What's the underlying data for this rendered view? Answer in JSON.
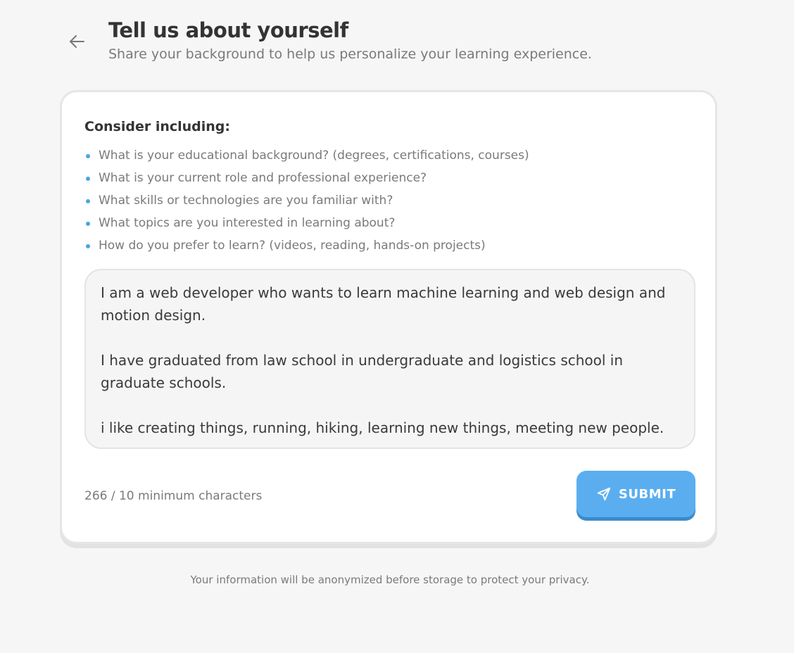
{
  "header": {
    "back_icon": "arrow-left-icon",
    "title": "Tell us about yourself",
    "subtitle": "Share your background to help us personalize your learning experience."
  },
  "card": {
    "consider_title": "Consider including:",
    "tips": [
      "What is your educational background? (degrees, certifications, courses)",
      "What is your current role and professional experience?",
      "What skills or technologies are you familiar with?",
      "What topics are you interested in learning about?",
      "How do you prefer to learn? (videos, reading, hands-on projects)"
    ],
    "textarea_value": "I am a web developer who wants to learn machine learning and web design and motion design.\n\nI have graduated from law school in undergraduate and logistics school in graduate schools.\n\ni like creating things, running, hiking, learning new things, meeting new people.",
    "char_count": "266 / 10 minimum characters",
    "submit_label": "SUBMIT",
    "submit_icon": "send-icon"
  },
  "footer": {
    "note": "Your information will be anonymized before storage to protect your privacy."
  },
  "colors": {
    "background": "#f6f6f6",
    "accent": "#5aaef0",
    "accent_shadow": "#3a8bcd",
    "bullet": "#4aa6de"
  }
}
